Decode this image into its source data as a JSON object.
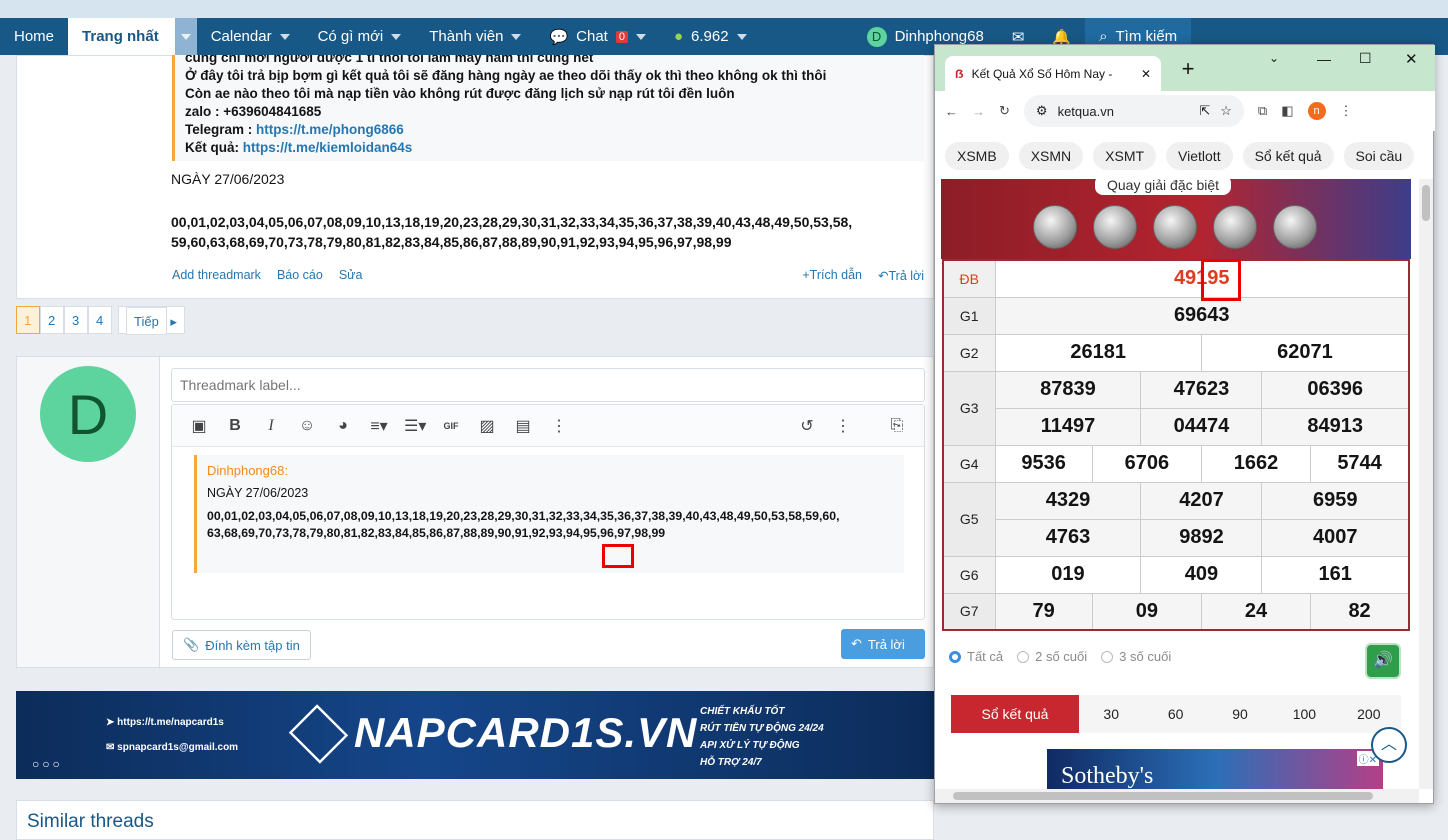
{
  "nav": {
    "home": "Home",
    "trang_nhat": "Trang nhất",
    "calendar": "Calendar",
    "co_gi_moi": "Có gì mới",
    "thanh_vien": "Thành viên",
    "chat": "Chat",
    "chat_badge": "0",
    "points": "6.962",
    "user_initial": "D",
    "username": "Dinhphong68",
    "search": "Tìm kiếm"
  },
  "post": {
    "quote_lines": [
      "cũng chỉ mời người được 1 tí thôi tôi làm mấy năm thì cũng hết",
      "Ở đây tôi trả bịp bợm gì kết quả tôi sẽ đăng hàng ngày ae theo dõi thấy ok thì theo không ok thì thôi",
      "Còn ae nào theo tôi mà nạp tiền vào không rút được đăng lịch sử nạp rút tôi đền luôn",
      "zalo : +639604841685"
    ],
    "telegram_label": "Telegram :",
    "telegram_link": "https://t.me/phong6866",
    "ketqua_label": "Kết quả:",
    "ketqua_link": "https://t.me/kiemloidan64s",
    "date": "NGÀY 27/06/2023",
    "numbers_line1": "00,01,02,03,04,05,06,07,08,09,10,13,18,19,20,23,28,29,30,31,32,33,34,35,36,37,38,39,40,43,48,49,50,53,58,",
    "numbers_line2": "59,60,63,68,69,70,73,78,79,80,81,82,83,84,85,86,87,88,89,90,91,92,93,94,95,96,97,98,99",
    "add_threadmark": "Add threadmark",
    "report": "Báo cáo",
    "edit": "Sửa",
    "quote_btn": "Trích dẫn",
    "reply_btn": "Trả lời"
  },
  "pager": {
    "pages": [
      "1",
      "2",
      "3",
      "4"
    ],
    "next": "Tiếp"
  },
  "reply": {
    "avatar_initial": "D",
    "threadmark_placeholder": "Threadmark label...",
    "quote_author": "Dinhphong68:",
    "quote_date": "NGÀY 27/06/2023",
    "quote_numbers_line1": "00,01,02,03,04,05,06,07,08,09,10,13,18,19,20,23,28,29,30,31,32,33,34,35,36,37,38,39,40,43,48,49,50,53,58,59,60,",
    "quote_numbers_line2": "63,68,69,70,73,78,79,80,81,82,83,84,85,86,87,88,89,90,91,92,93,94,95,96,97,98,99",
    "attach": "Đính kèm tập tin",
    "submit": "Trả lời"
  },
  "banner": {
    "telegram": "https://t.me/napcard1s",
    "email": "spnapcard1s@gmail.com",
    "brand": "NAPCARD1S.VN",
    "features": [
      "CHIẾT KHẤU TỐT",
      "RÚT TIỀN TỰ ĐỘNG 24/24",
      "API XỬ LÝ TỰ ĐỘNG",
      "HỖ TRỢ 24/7"
    ]
  },
  "similar": "Similar threads",
  "browser": {
    "tab_title": "Kết Quả Xổ Số Hôm Nay -",
    "url": "ketqua.vn",
    "profile": "n",
    "categories": [
      "XSMB",
      "XSMN",
      "XSMT",
      "Vietlott",
      "Sổ kết quả",
      "Soi cầu"
    ],
    "hero_label": "Quay giải đặc biệt",
    "results": {
      "db_label": "ĐB",
      "db": "49195",
      "g1_label": "G1",
      "g1": [
        "69643"
      ],
      "g2_label": "G2",
      "g2": [
        "26181",
        "62071"
      ],
      "g3_label": "G3",
      "g3": [
        "87839",
        "47623",
        "06396",
        "11497",
        "04474",
        "84913"
      ],
      "g4_label": "G4",
      "g4": [
        "9536",
        "6706",
        "1662",
        "5744"
      ],
      "g5_label": "G5",
      "g5": [
        "4329",
        "4207",
        "6959",
        "4763",
        "9892",
        "4007"
      ],
      "g6_label": "G6",
      "g6": [
        "019",
        "409",
        "161"
      ],
      "g7_label": "G7",
      "g7": [
        "79",
        "09",
        "24",
        "82"
      ]
    },
    "filters": [
      "Tất cả",
      "2 số cuối",
      "3 số cuối"
    ],
    "so_ket_qua": "Sổ kết quả",
    "counts": [
      "30",
      "60",
      "90",
      "100",
      "200"
    ],
    "ad_text": "Sotheby's"
  }
}
